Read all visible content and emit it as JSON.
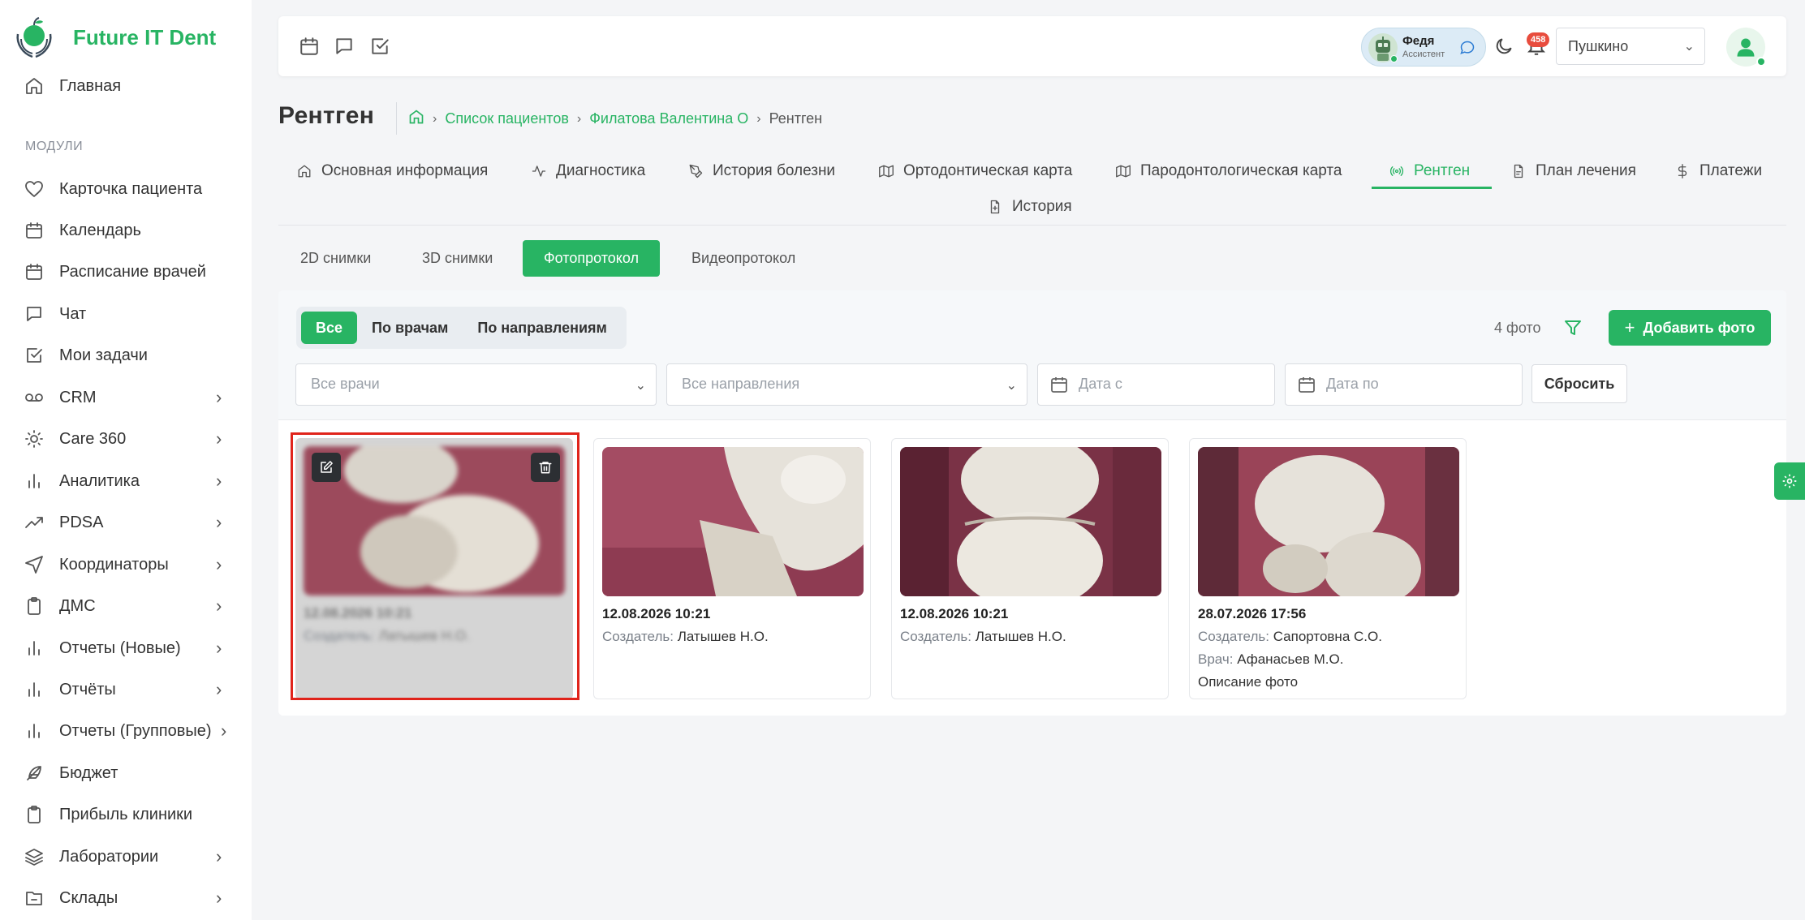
{
  "app": {
    "brand": "Future IT Dent",
    "accent_color": "#28b463"
  },
  "sidebar": {
    "home": {
      "label": "Главная",
      "icon": "home-icon"
    },
    "section_label": "МОДУЛИ",
    "items": [
      {
        "label": "Карточка пациента",
        "icon": "heart-icon",
        "has_children": false
      },
      {
        "label": "Календарь",
        "icon": "calendar-icon",
        "has_children": false
      },
      {
        "label": "Расписание врачей",
        "icon": "calendar-icon",
        "has_children": false
      },
      {
        "label": "Чат",
        "icon": "chat-icon",
        "has_children": false
      },
      {
        "label": "Мои задачи",
        "icon": "checkbox-icon",
        "has_children": false
      },
      {
        "label": "CRM",
        "icon": "voicemail-icon",
        "has_children": true
      },
      {
        "label": "Care 360",
        "icon": "sun-icon",
        "has_children": true
      },
      {
        "label": "Аналитика",
        "icon": "bar-chart-icon",
        "has_children": true
      },
      {
        "label": "PDSA",
        "icon": "trending-up-icon",
        "has_children": true
      },
      {
        "label": "Координаторы",
        "icon": "send-icon",
        "has_children": true
      },
      {
        "label": "ДМС",
        "icon": "clipboard-icon",
        "has_children": true
      },
      {
        "label": "Отчеты (Новые)",
        "icon": "bar-chart-icon",
        "has_children": true
      },
      {
        "label": "Отчёты",
        "icon": "bar-chart-icon",
        "has_children": true
      },
      {
        "label": "Отчеты (Групповые)",
        "icon": "bar-chart-icon",
        "has_children": true
      },
      {
        "label": "Бюджет",
        "icon": "feather-icon",
        "has_children": false
      },
      {
        "label": "Прибыль клиники",
        "icon": "clipboard-icon",
        "has_children": false
      },
      {
        "label": "Лаборатории",
        "icon": "layers-icon",
        "has_children": true
      },
      {
        "label": "Склады",
        "icon": "folder-minus-icon",
        "has_children": true
      }
    ]
  },
  "topbar": {
    "assistant_name": "Федя",
    "assistant_role": "Ассистент",
    "notifications_count": "458",
    "branch": "Пушкино"
  },
  "page": {
    "title": "Рентген",
    "breadcrumb": [
      "Список пациентов",
      "Филатова Валентина О",
      "Рентген"
    ]
  },
  "tabs": [
    {
      "label": "Основная информация",
      "icon": "home-icon"
    },
    {
      "label": "Диагностика",
      "icon": "activity-icon"
    },
    {
      "label": "История болезни",
      "icon": "pen-tool-icon"
    },
    {
      "label": "Ортодонтическая карта",
      "icon": "map-icon"
    },
    {
      "label": "Пародонтологическая карта",
      "icon": "map-icon"
    },
    {
      "label": "Рентген",
      "icon": "radio-icon",
      "active": true
    },
    {
      "label": "План лечения",
      "icon": "file-icon"
    },
    {
      "label": "Платежи",
      "icon": "dollar-icon"
    },
    {
      "label": "История",
      "icon": "file-plus-icon"
    }
  ],
  "subtabs": [
    {
      "label": "2D снимки"
    },
    {
      "label": "3D снимки"
    },
    {
      "label": "Фотопротокол",
      "active": true
    },
    {
      "label": "Видеопротокол"
    }
  ],
  "photos_panel": {
    "group_options": [
      "Все",
      "По врачам",
      "По направлениям"
    ],
    "group_selected": "Все",
    "count_text": "4 фото",
    "add_button": "Добавить фото",
    "doctors_placeholder": "Все врачи",
    "directions_placeholder": "Все направления",
    "date_from_placeholder": "Дата с",
    "date_to_placeholder": "Дата по",
    "reset_button": "Сбросить",
    "creator_label": "Создатель:",
    "doctor_label": "Врач:"
  },
  "photos": [
    {
      "date": "12.08.2026 10:21",
      "creator": "Латышев Н.О.",
      "doctor": "",
      "description": "",
      "state": "blurred-selected"
    },
    {
      "date": "12.08.2026 10:21",
      "creator": "Латышев Н.О.",
      "doctor": "",
      "description": ""
    },
    {
      "date": "12.08.2026 10:21",
      "creator": "Латышев Н.О.",
      "doctor": "",
      "description": ""
    },
    {
      "date": "28.07.2026 17:56",
      "creator": "Сапортовна С.О.",
      "doctor": "Афанасьев М.О.",
      "description": "Описание фото"
    }
  ]
}
